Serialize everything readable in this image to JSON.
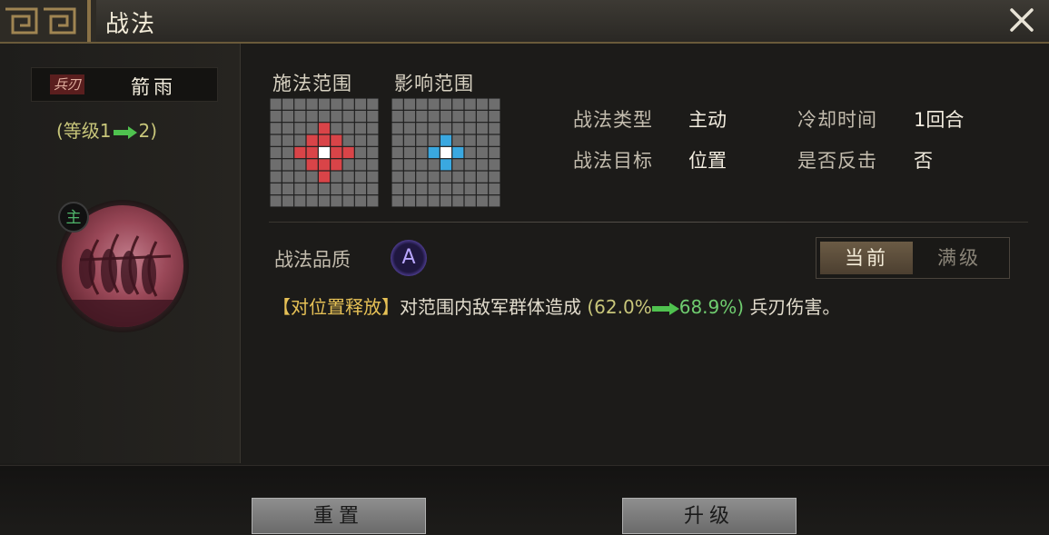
{
  "window": {
    "title": "战法",
    "close_icon": "close-icon"
  },
  "skill": {
    "type_badge": "兵刃",
    "name": "箭雨",
    "level_open": "(等级1",
    "level_close": "2)",
    "main_badge": "主",
    "portrait_icon": "archers-portrait-icon"
  },
  "ranges": {
    "cast_label": "施法范围",
    "effect_label": "影响范围",
    "grid_size": 9,
    "cast_cells": [
      [
        4,
        2
      ],
      [
        3,
        3
      ],
      [
        4,
        3
      ],
      [
        5,
        3
      ],
      [
        2,
        4
      ],
      [
        3,
        4
      ],
      [
        5,
        4
      ],
      [
        6,
        4
      ],
      [
        3,
        5
      ],
      [
        4,
        5
      ],
      [
        5,
        5
      ],
      [
        4,
        6
      ]
    ],
    "cast_center": [
      4,
      4
    ],
    "cast_color": "#d94448",
    "effect_cells": [
      [
        4,
        3
      ],
      [
        3,
        4
      ],
      [
        5,
        4
      ],
      [
        4,
        5
      ]
    ],
    "effect_center": [
      4,
      4
    ],
    "effect_color": "#3aa8e0"
  },
  "info": {
    "type_label": "战法类型",
    "type_value": "主动",
    "cooldown_label": "冷却时间",
    "cooldown_value": "1回合",
    "target_label": "战法目标",
    "target_value": "位置",
    "counter_label": "是否反击",
    "counter_value": "否"
  },
  "quality": {
    "label": "战法品质",
    "grade": "A"
  },
  "toggle": {
    "current": "当前",
    "max": "满级"
  },
  "description": {
    "tag": "【对位置释放】",
    "text_before": "对范围内敌军群体造成",
    "paren_open": "(",
    "old_value": "62.0%",
    "new_value": "68.9%",
    "paren_close": ")",
    "text_after": "兵刃伤害。"
  },
  "buttons": {
    "reset": "重置",
    "upgrade": "升级"
  }
}
